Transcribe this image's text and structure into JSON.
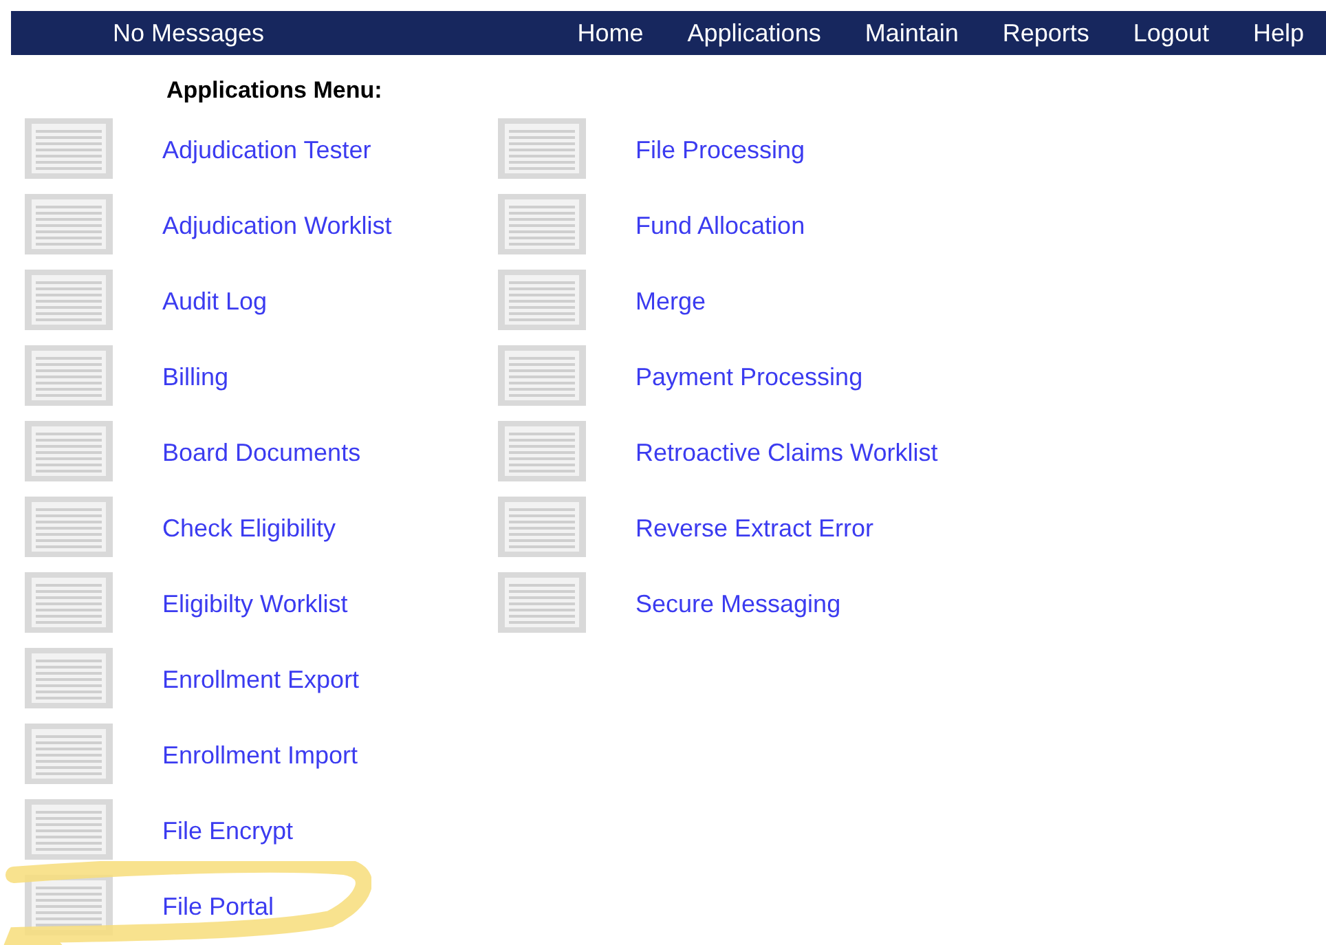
{
  "nav": {
    "status": "No Messages",
    "links": [
      "Home",
      "Applications",
      "Maintain",
      "Reports",
      "Logout",
      "Help"
    ]
  },
  "menu": {
    "title": "Applications Menu:",
    "columns": [
      [
        {
          "label": "Adjudication Tester",
          "highlighted": false
        },
        {
          "label": "Adjudication Worklist",
          "highlighted": false
        },
        {
          "label": "Audit Log",
          "highlighted": false
        },
        {
          "label": "Billing",
          "highlighted": false
        },
        {
          "label": "Board Documents",
          "highlighted": false
        },
        {
          "label": "Check Eligibility",
          "highlighted": false
        },
        {
          "label": "Eligibilty Worklist",
          "highlighted": false
        },
        {
          "label": "Enrollment Export",
          "highlighted": false
        },
        {
          "label": "Enrollment Import",
          "highlighted": false
        },
        {
          "label": "File Encrypt",
          "highlighted": false
        },
        {
          "label": "File Portal",
          "highlighted": true
        }
      ],
      [
        {
          "label": "File Processing",
          "highlighted": false
        },
        {
          "label": "Fund Allocation",
          "highlighted": false
        },
        {
          "label": "Merge",
          "highlighted": false
        },
        {
          "label": "Payment Processing",
          "highlighted": false
        },
        {
          "label": "Retroactive Claims Worklist",
          "highlighted": false
        },
        {
          "label": "Reverse Extract Error",
          "highlighted": false
        },
        {
          "label": "Secure Messaging",
          "highlighted": false
        }
      ]
    ]
  }
}
